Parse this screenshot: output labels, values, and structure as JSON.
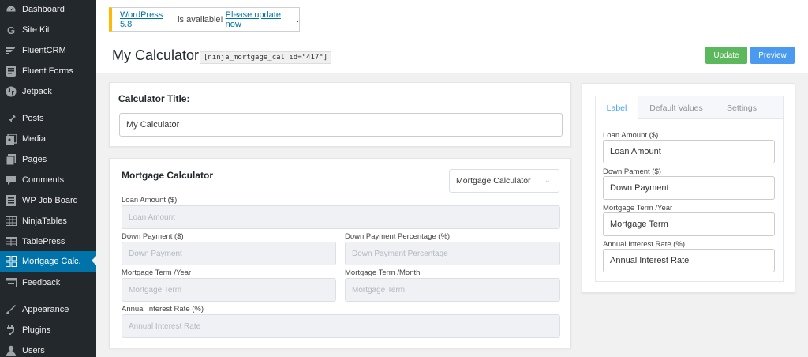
{
  "sidebar": {
    "items": [
      {
        "label": "Dashboard",
        "icon": "dashboard-icon"
      },
      {
        "label": "Site Kit",
        "icon": "sitekit-icon"
      },
      {
        "label": "FluentCRM",
        "icon": "fluentcrm-icon"
      },
      {
        "label": "Fluent Forms",
        "icon": "forms-icon"
      },
      {
        "label": "Jetpack",
        "icon": "jetpack-icon"
      },
      {
        "label": "Posts",
        "icon": "pin-icon"
      },
      {
        "label": "Media",
        "icon": "media-icon"
      },
      {
        "label": "Pages",
        "icon": "pages-icon"
      },
      {
        "label": "Comments",
        "icon": "comments-icon"
      },
      {
        "label": "WP Job Board",
        "icon": "jobboard-icon"
      },
      {
        "label": "NinjaTables",
        "icon": "tables-icon"
      },
      {
        "label": "TablePress",
        "icon": "tablepress-icon"
      },
      {
        "label": "Mortgage Calc.",
        "icon": "calculator-icon"
      },
      {
        "label": "Feedback",
        "icon": "feedback-icon"
      },
      {
        "label": "Appearance",
        "icon": "appearance-icon"
      },
      {
        "label": "Plugins",
        "icon": "plugins-icon"
      },
      {
        "label": "Users",
        "icon": "users-icon"
      }
    ],
    "active_index": 12
  },
  "notice": {
    "link1": "WordPress 5.8",
    "middle": " is available! ",
    "link2": "Please update now",
    "end": "."
  },
  "header": {
    "title": "My Calculator",
    "shortcode": "[ninja_mortgage_cal id=\"417\"]",
    "update_label": "Update",
    "preview_label": "Preview"
  },
  "title_panel": {
    "heading": "Calculator Title:",
    "value": "My Calculator"
  },
  "calc_panel": {
    "heading": "Mortgage Calculator",
    "type_select": "Mortgage Calculator",
    "fields": {
      "loan_amount": {
        "label": "Loan Amount ($)",
        "placeholder": "Loan Amount"
      },
      "down_payment": {
        "label": "Down Payment ($)",
        "placeholder": "Down Payment"
      },
      "down_payment_pct": {
        "label": "Down Payment Percentage (%)",
        "placeholder": "Down Payment Percentage"
      },
      "term_year": {
        "label": "Mortgage Term /Year",
        "placeholder": "Mortgage Term"
      },
      "term_month": {
        "label": "Mortgage Term /Month",
        "placeholder": "Mortgage Term"
      },
      "interest": {
        "label": "Annual Interest Rate (%)",
        "placeholder": "Annual Interest Rate"
      }
    }
  },
  "settings_panel": {
    "tabs": [
      "Label",
      "Default Values",
      "Settings"
    ],
    "active_tab": 0,
    "fields": [
      {
        "label": "Loan Amount ($)",
        "value": "Loan Amount"
      },
      {
        "label": "Down Pament ($)",
        "value": "Down Payment"
      },
      {
        "label": "Mortgage Term /Year",
        "value": "Mortgage Term"
      },
      {
        "label": "Annual Interest Rate (%)",
        "value": "Annual Interest Rate"
      }
    ]
  },
  "colors": {
    "sidebar_bg": "#23282d",
    "active": "#0073aa",
    "update_btn": "#5cb85c",
    "preview_btn": "#4a9bef",
    "tab_active": "#409eff"
  }
}
